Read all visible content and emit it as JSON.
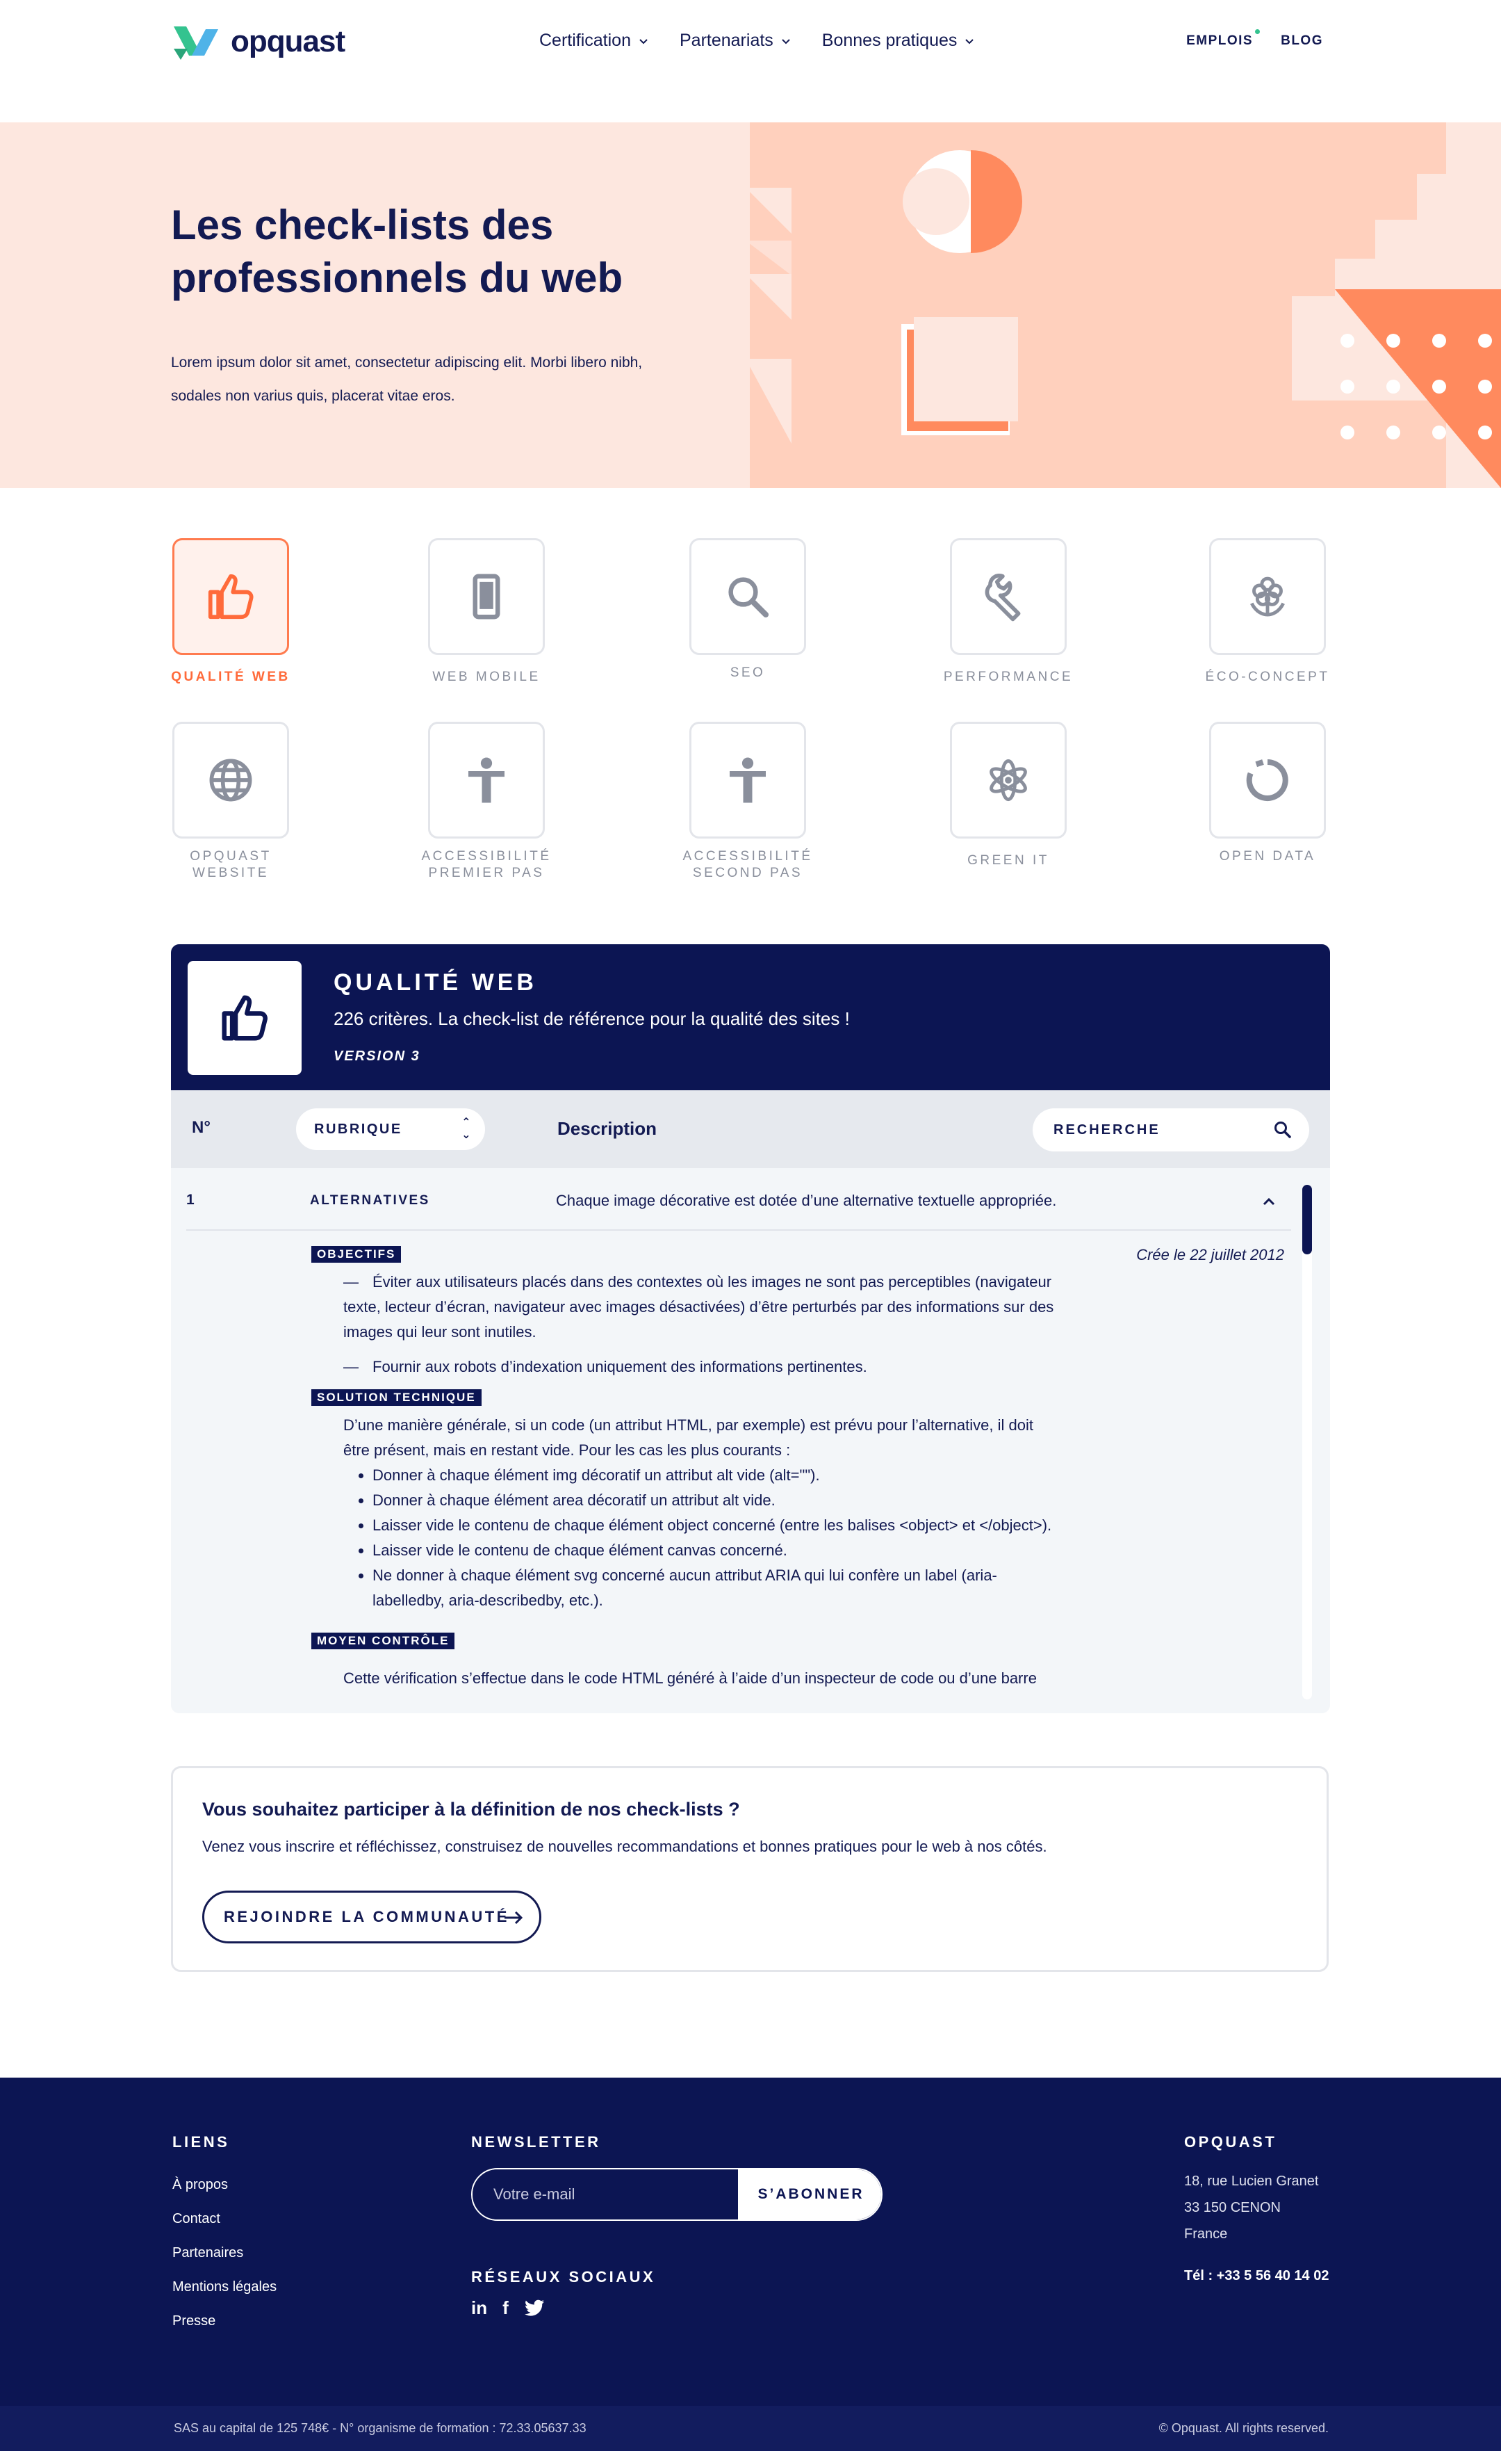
{
  "brand": {
    "name": "opquast",
    "accent": "#ff7b4f",
    "navy": "#0c1553"
  },
  "header": {
    "nav": [
      "Certification",
      "Partenariats",
      "Bonnes pratiques"
    ],
    "right_links": [
      "EMPLOIS",
      "BLOG"
    ]
  },
  "hero": {
    "title": "Les check-lists des professionnels du web",
    "text": "Lorem ipsum dolor sit amet, consectetur adipiscing elit. Morbi libero nibh, sodales non varius quis, placerat vitae eros."
  },
  "categories": [
    {
      "label": "QUALITÉ WEB",
      "icon": "thumbs-up-icon",
      "active": true
    },
    {
      "label": "WEB MOBILE",
      "icon": "mobile-icon"
    },
    {
      "label": "SEO",
      "icon": "search-icon"
    },
    {
      "label": "PERFORMANCE",
      "icon": "wrench-icon"
    },
    {
      "label": "ÉCO-CONCEPT",
      "icon": "flower-icon"
    },
    {
      "label": "OPQUAST WEBSITE",
      "icon": "globe-icon"
    },
    {
      "label": "ACCESSIBILITÉ PREMIER PAS",
      "icon": "person-icon"
    },
    {
      "label": "ACCESSIBILITÉ SECOND PAS",
      "icon": "person-icon"
    },
    {
      "label": "GREEN IT",
      "icon": "atom-icon"
    },
    {
      "label": "OPEN DATA",
      "icon": "ring-icon"
    }
  ],
  "checklist": {
    "title": "QUALITÉ WEB",
    "subtitle": "226 critères. La check-list de référence pour la qualité des sites !",
    "version": "VERSION 3",
    "columns": {
      "number": "N°",
      "rubrique": "RUBRIQUE",
      "description": "Description"
    },
    "search_placeholder": "RECHERCHE",
    "row": {
      "number": "1",
      "rubrique": "ALTERNATIVES",
      "description": "Chaque image décorative est dotée d’une alternative textuelle appropriée.",
      "created": "Crée le 22 juillet 2012",
      "objectifs_label": "OBJECTIFS",
      "objectifs": [
        "Éviter aux utilisateurs placés dans des contextes où les images ne sont pas perceptibles (navigateur texte, lecteur d’écran, navigateur avec images désactivées) d’être perturbés par des informations sur des images qui leur sont inutiles.",
        "Fournir aux robots d’indexation uniquement des informations pertinentes."
      ],
      "solution_label": "SOLUTION TECHNIQUE",
      "solution_intro": "D’une manière générale, si un code (un attribut HTML, par exemple) est prévu pour l’alternative, il doit être présent, mais en restant vide. Pour les cas les plus courants :",
      "solution_items": [
        "Donner à chaque élément img décoratif un attribut alt vide (alt=\"\").",
        "Donner à chaque élément area décoratif un attribut alt vide.",
        "Laisser vide le contenu de chaque élément object concerné (entre les balises <object> et </object>).",
        "Laisser vide le contenu de chaque élément canvas concerné.",
        "Ne donner à chaque élément svg concerné aucun attribut ARIA qui lui confère un label (aria-labelledby, aria-describedby, etc.)."
      ],
      "controle_label": "MOYEN CONTRÔLE",
      "controle_text": "Cette vérification s’effectue dans le code HTML généré à l’aide d’un inspecteur de code ou d’une barre"
    }
  },
  "cta": {
    "title": "Vous souhaitez participer à la définition de nos check-lists ?",
    "text": "Venez vous inscrire et réfléchissez, construisez de nouvelles recommandations et bonnes pratiques pour le web à nos côtés.",
    "button": "REJOINDRE LA COMMUNAUTÉ"
  },
  "footer": {
    "links_title": "LIENS",
    "links": [
      "À propos",
      "Contact",
      "Partenaires",
      "Mentions légales",
      "Presse"
    ],
    "newsletter_title": "NEWSLETTER",
    "newsletter_placeholder": "Votre e-mail",
    "newsletter_button": "S’ABONNER",
    "social_title": "RÉSEAUX SOCIAUX",
    "social": [
      "in",
      "f",
      "twitter-icon"
    ],
    "company_title": "OPQUAST",
    "address": [
      "18, rue Lucien Granet",
      "33 150 CENON",
      "France"
    ],
    "tel": "Tél : +33 5 56 40 14 02",
    "legal": "SAS au capital de 125 748€ - N° organisme de formation : 72.33.05637.33",
    "copyright": "© Opquast. All rights reserved."
  }
}
